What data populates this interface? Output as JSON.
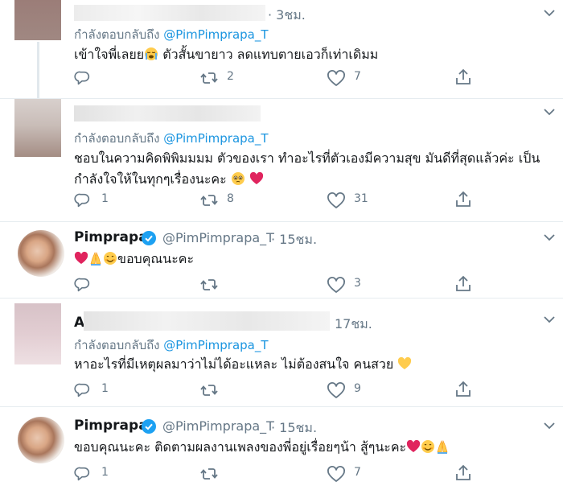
{
  "tweets": [
    {
      "time": "· 3ชม.",
      "replying_prefix": "กำลังตอบกลับถึง",
      "replying_to": "@PimPimprapa_T",
      "text": "เข้าใจพี่เลยย",
      "text_after": " ตัวสั้นขายาว ลดแทบตายเอวก็เท่าเดิมม",
      "emoji": [
        "crying-face"
      ],
      "replies": "",
      "retweets": "2",
      "likes": "7"
    },
    {
      "replying_prefix": "กำลังตอบกลับถึง",
      "replying_to": "@PimPimprapa_T",
      "text_line1": "ชอบในความคิดพิพิมมมม ตัวของเรา ทำอะไรที่ตัวเองมีความสุข มันดีที่สุดแล้วค่ะ เป็น",
      "text_line2": "กำลังใจให้ในทุกๆเรื่องนะคะ",
      "emoji": [
        "pleading-face",
        "red-heart"
      ],
      "replies": "1",
      "retweets": "8",
      "likes": "31"
    },
    {
      "name": "Pimprapa",
      "handle": "@PimPimprapa_T",
      "time": "· 15ชม.",
      "text": "ขอบคุณนะคะ",
      "emoji": [
        "red-heart",
        "folded-hands",
        "smiling-face"
      ],
      "replies": "",
      "retweets": "",
      "likes": "3"
    },
    {
      "name_initial": "A",
      "time": "17ชม.",
      "replying_prefix": "กำลังตอบกลับถึง",
      "replying_to": "@PimPimprapa_T",
      "text": "หาอะไรที่มีเหตุผลมาว่าไม่ได้อะแหละ ไม่ต้องสนใจ คนสวย",
      "emoji": [
        "yellow-heart"
      ],
      "replies": "1",
      "retweets": "",
      "likes": "9"
    },
    {
      "name": "Pimprapa",
      "handle": "@PimPimprapa_T",
      "time": "· 15ชม.",
      "text": "ขอบคุณนะคะ ติดตามผลงานเพลงของพี่อยู่เรื่อยๆน้า สู้ๆนะคะ",
      "emoji": [
        "red-heart",
        "smiling-face",
        "folded-hands"
      ],
      "replies": "1",
      "retweets": "",
      "likes": "7"
    }
  ],
  "colors": {
    "link": "#1b95e0",
    "muted": "#657786",
    "text": "#14171a",
    "separator": "#e6ecf0",
    "verified": "#1da1f2",
    "heart": "#e0245e"
  }
}
